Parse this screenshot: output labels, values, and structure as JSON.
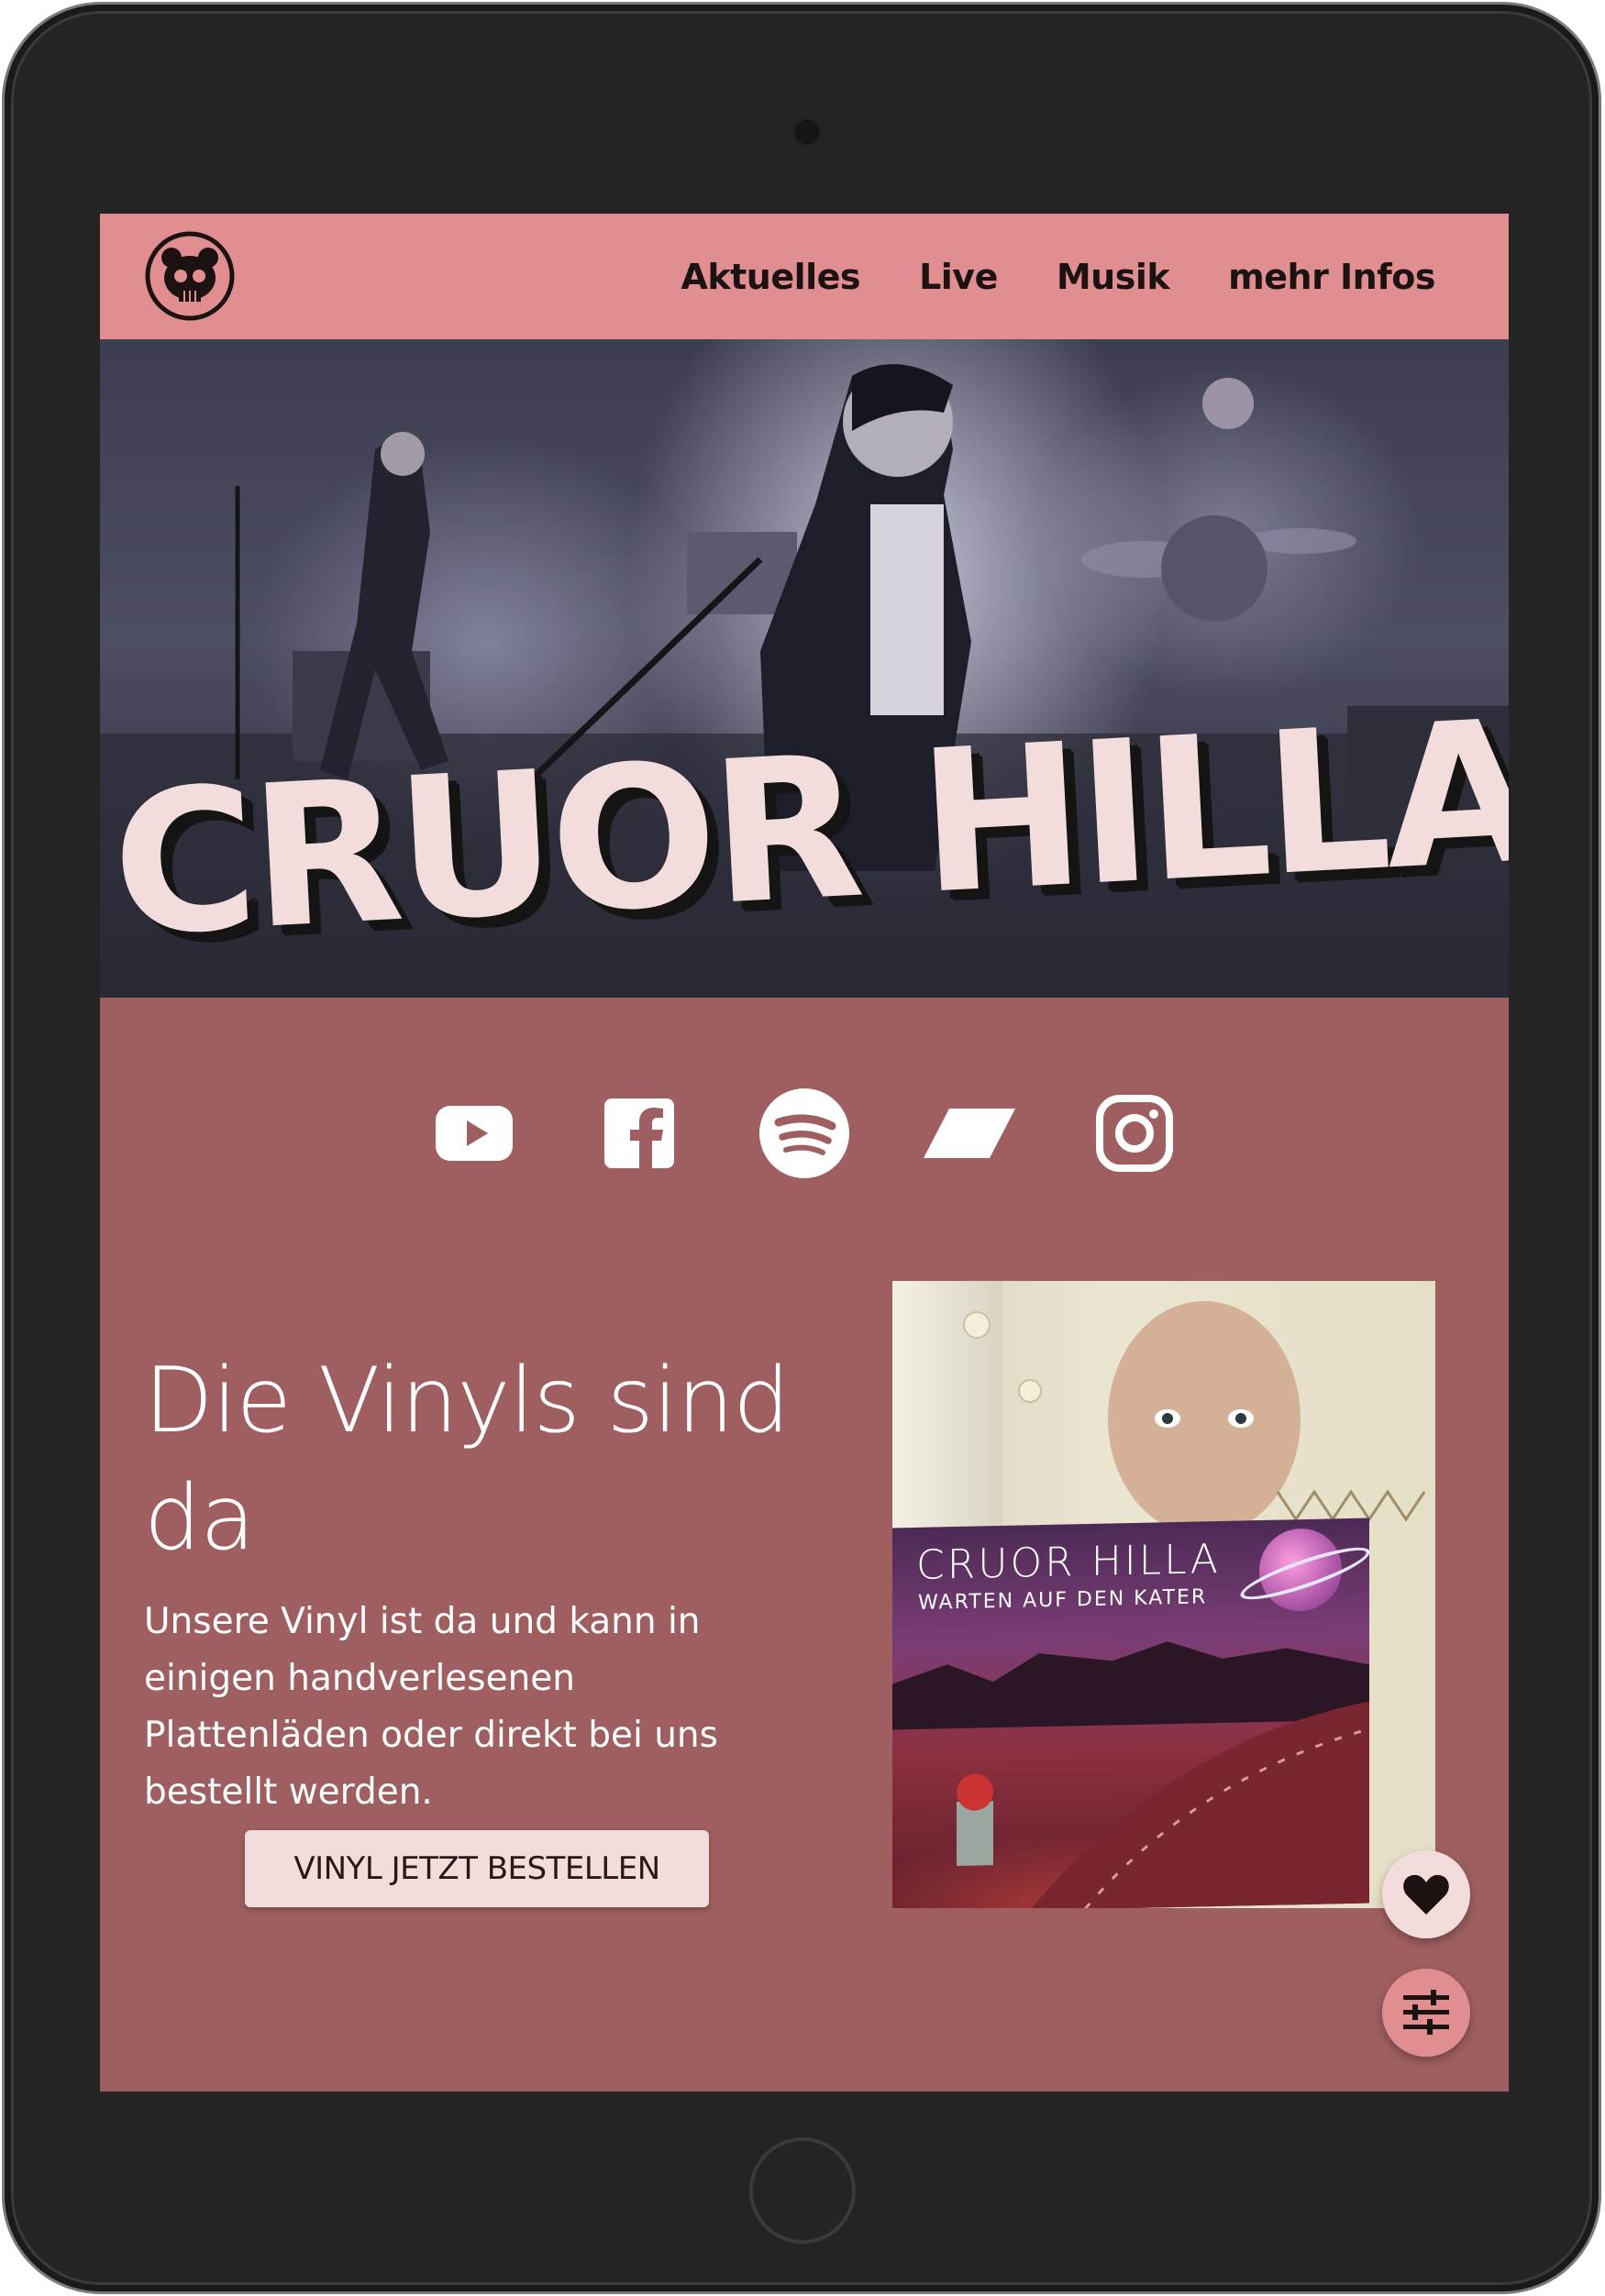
{
  "nav": {
    "items": [
      {
        "label": "Aktuelles"
      },
      {
        "label": "Live"
      },
      {
        "label": "Musik"
      },
      {
        "label": "mehr Infos"
      }
    ]
  },
  "hero": {
    "band_name": "CRUOR HILLA"
  },
  "social": {
    "icons": [
      "youtube-icon",
      "facebook-icon",
      "spotify-icon",
      "bandcamp-icon",
      "instagram-icon"
    ]
  },
  "feature": {
    "headline": "Die Vinyls sind da",
    "body": "Unsere Vinyl ist da und kann in einigen handverlesenen Plattenläden oder direkt bei uns bestellt werden.",
    "cta_label": "VINYL JETZT BESTELLEN"
  },
  "album": {
    "title": "CRUOR HILLA",
    "subtitle": "WARTEN AUF DEN KATER"
  },
  "fabs": {
    "heart_icon": "heart-icon",
    "filter_icon": "tune-icon"
  },
  "colors": {
    "navbar": "#e08e90",
    "page_background": "#9f5f60",
    "accent_light": "#f3dcdc"
  }
}
